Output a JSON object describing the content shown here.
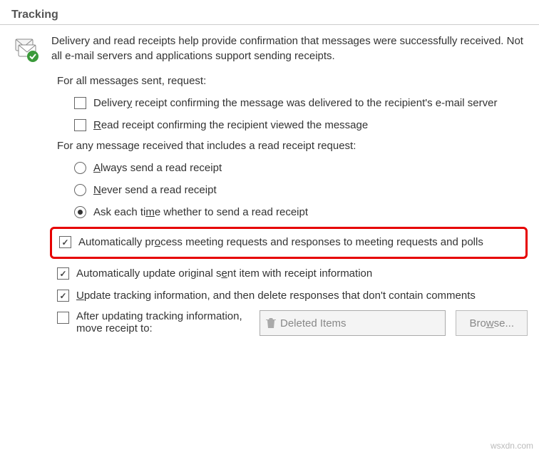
{
  "section_title": "Tracking",
  "intro": "Delivery and read receipts help provide confirmation that messages were successfully received. Not all e-mail servers and applications support sending receipts.",
  "request_label": "For all messages sent, request:",
  "delivery_receipt": {
    "pre": "Delivery receipt confirming the message was delivered to the recipient's e-mail server",
    "full_pre": "Deliver",
    "u": "y",
    "post": " receipt confirming the message was delivered to the recipient's e-mail server"
  },
  "read_receipt": {
    "u": "R",
    "post": "ead receipt confirming the recipient viewed the message"
  },
  "any_message_label": "For any message received that includes a read receipt request:",
  "radio_always": {
    "u": "A",
    "post": "lways send a read receipt"
  },
  "radio_never": {
    "u": "N",
    "post": "ever send a read receipt"
  },
  "radio_ask": {
    "pre": "Ask each ti",
    "u": "m",
    "post": "e whether to send a read receipt"
  },
  "auto_process": {
    "pre": "Automatically pr",
    "u": "o",
    "post": "cess meeting requests and responses to meeting requests and polls"
  },
  "auto_update": {
    "pre": "Automatically update original s",
    "u": "e",
    "post": "nt item with receipt information"
  },
  "update_tracking": {
    "u": "U",
    "post": "pdate tracking information, and then delete responses that don't contain comments"
  },
  "after_updating": {
    "pre": "After updatin",
    "u": "g",
    "post": " tracking information, move receipt to:"
  },
  "deleted_items_field": "Deleted Items",
  "browse_btn": {
    "pre": "Bro",
    "u": "w",
    "post": "se..."
  },
  "watermark": "wsxdn.com"
}
